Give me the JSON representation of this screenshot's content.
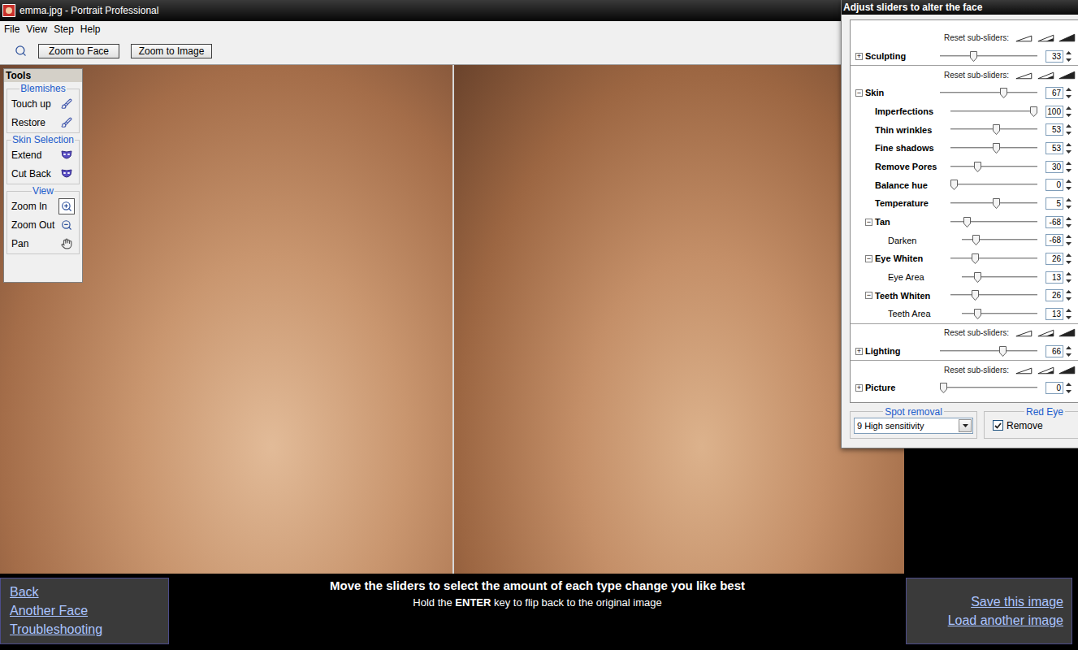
{
  "window": {
    "title": "emma.jpg - Portrait Professional"
  },
  "menu": [
    "File",
    "View",
    "Step",
    "Help"
  ],
  "toolbar": {
    "buttons": [
      "Zoom to Face",
      "Zoom to Image"
    ]
  },
  "tools": {
    "title": "Tools",
    "groups": [
      {
        "label": "Blemishes",
        "items": [
          {
            "label": "Touch up",
            "selected": false
          },
          {
            "label": "Restore",
            "selected": false
          }
        ]
      },
      {
        "label": "Skin Selection",
        "items": [
          {
            "label": "Extend",
            "selected": false
          },
          {
            "label": "Cut Back",
            "selected": false
          }
        ]
      },
      {
        "label": "View",
        "items": [
          {
            "label": "Zoom In",
            "selected": true
          },
          {
            "label": "Zoom Out",
            "selected": false
          },
          {
            "label": "Pan",
            "selected": false
          }
        ]
      }
    ]
  },
  "sliders_panel": {
    "title": "Adjust sliders to alter the face",
    "rows": [
      {
        "kind": "reset",
        "label": "Reset sub-sliders:"
      },
      {
        "kind": "slider",
        "label": "Sculpting",
        "expander": "+",
        "depth": 0,
        "value": "33",
        "level": 0.33
      },
      {
        "kind": "reset",
        "label": "Reset sub-sliders:"
      },
      {
        "kind": "slider",
        "label": "Skin",
        "expander": "−",
        "depth": 0,
        "value": "67",
        "level": 0.67
      },
      {
        "kind": "slider",
        "label": "Imperfections",
        "expander": "",
        "depth": 1,
        "value": "100",
        "level": 1
      },
      {
        "kind": "slider",
        "label": "Thin wrinkles",
        "expander": "",
        "depth": 1,
        "value": "53",
        "level": 0.53
      },
      {
        "kind": "slider",
        "label": "Fine shadows",
        "expander": "",
        "depth": 1,
        "value": "53",
        "level": 0.53
      },
      {
        "kind": "slider",
        "label": "Remove Pores",
        "expander": "",
        "depth": 1,
        "value": "30",
        "level": 0.3
      },
      {
        "kind": "slider",
        "label": "Balance hue",
        "expander": "",
        "depth": 1,
        "value": "0",
        "level": 0
      },
      {
        "kind": "slider",
        "label": "Temperature",
        "expander": "",
        "depth": 1,
        "value": "5",
        "level": 0.53
      },
      {
        "kind": "slider",
        "label": "Tan",
        "expander": "−",
        "depth": 1,
        "value": "-68",
        "level": 0.16
      },
      {
        "kind": "slider",
        "label": "Darken",
        "expander": "",
        "depth": 2,
        "value": "-68",
        "level": 0.16
      },
      {
        "kind": "slider",
        "label": "Eye Whiten",
        "expander": "−",
        "depth": 1,
        "value": "26",
        "level": 0.27
      },
      {
        "kind": "slider",
        "label": "Eye Area",
        "expander": "",
        "depth": 2,
        "value": "13",
        "level": 0.18
      },
      {
        "kind": "slider",
        "label": "Teeth Whiten",
        "expander": "−",
        "depth": 1,
        "value": "26",
        "level": 0.27
      },
      {
        "kind": "slider",
        "label": "Teeth Area",
        "expander": "",
        "depth": 2,
        "value": "13",
        "level": 0.18
      },
      {
        "kind": "reset",
        "label": "Reset sub-sliders:"
      },
      {
        "kind": "slider",
        "label": "Lighting",
        "expander": "+",
        "depth": 0,
        "value": "66",
        "level": 0.66
      },
      {
        "kind": "reset",
        "label": "Reset sub-sliders:"
      },
      {
        "kind": "slider",
        "label": "Picture",
        "expander": "+",
        "depth": 0,
        "value": "0",
        "level": 0
      }
    ],
    "spot_removal": {
      "label": "Spot removal",
      "value": "9 High sensitivity"
    },
    "red_eye": {
      "label": "Red Eye",
      "checkbox": {
        "label": "Remove",
        "checked": true
      }
    }
  },
  "status": {
    "instruction": "Move the sliders to select the amount of each type change you like best",
    "hint": [
      {
        "text": "Hold the ",
        "bold": false
      },
      {
        "text": "ENTER",
        "bold": true
      },
      {
        "text": " key to flip back to the original image",
        "bold": false
      }
    ]
  },
  "nav_left": [
    "Back",
    "Another Face",
    "Troubleshooting"
  ],
  "nav_right": [
    "Save this image",
    "Load another image"
  ]
}
